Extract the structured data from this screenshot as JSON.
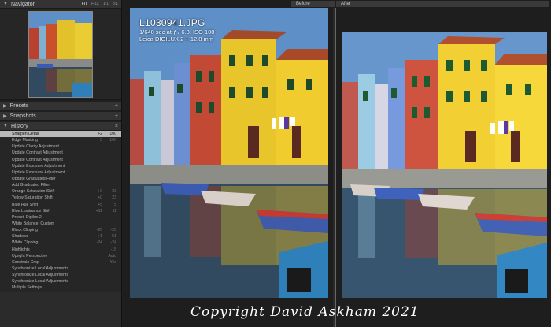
{
  "navigator": {
    "title": "Navigator",
    "zoom_options": [
      "FIT",
      "FILL",
      "1:1",
      "3:1"
    ]
  },
  "presets": {
    "title": "Presets",
    "action": "+"
  },
  "snapshots": {
    "title": "Snapshots",
    "action": "+"
  },
  "history": {
    "title": "History",
    "action": "×",
    "items": [
      {
        "label": "Sharpen Detail",
        "v1": "+2",
        "v2": "100",
        "selected": true
      },
      {
        "label": "Edge Masking",
        "v1": "3",
        "v2": "100"
      },
      {
        "label": "Update Clarity Adjustment",
        "v1": "",
        "v2": ""
      },
      {
        "label": "Update Contrast Adjustment",
        "v1": "",
        "v2": ""
      },
      {
        "label": "Update Contrast Adjustment",
        "v1": "",
        "v2": ""
      },
      {
        "label": "Update Exposure Adjustment",
        "v1": "",
        "v2": ""
      },
      {
        "label": "Update Exposure Adjustment",
        "v1": "",
        "v2": ""
      },
      {
        "label": "Update Graduated Filter",
        "v1": "",
        "v2": ""
      },
      {
        "label": "Add Graduated Filter",
        "v1": "",
        "v2": ""
      },
      {
        "label": "Orange Saturation Shift",
        "v1": "+0",
        "v2": "23"
      },
      {
        "label": "Yellow Saturation Shift",
        "v1": "+0",
        "v2": "23"
      },
      {
        "label": "Blue Hue Shift",
        "v1": "+5",
        "v2": "5"
      },
      {
        "label": "Blue Luminance Shift",
        "v1": "+11",
        "v2": "11"
      },
      {
        "label": "Preset: Digilux 2",
        "v1": "",
        "v2": ""
      },
      {
        "label": "White Balance: Custom",
        "v1": "",
        "v2": ""
      },
      {
        "label": "Black Clipping",
        "v1": "-20",
        "v2": "-20"
      },
      {
        "label": "Shadows",
        "v1": "+1",
        "v2": "51"
      },
      {
        "label": "White Clipping",
        "v1": "-24",
        "v2": "-24"
      },
      {
        "label": "Highlights",
        "v1": "",
        "v2": "-15"
      },
      {
        "label": "Upright Perspective",
        "v1": "",
        "v2": "Auto"
      },
      {
        "label": "Constrain Crop",
        "v1": "",
        "v2": "Yes"
      },
      {
        "label": "Synchronize Local Adjustments",
        "v1": "",
        "v2": ""
      },
      {
        "label": "Synchronize Local Adjustments",
        "v1": "",
        "v2": ""
      },
      {
        "label": "Synchronize Local Adjustments",
        "v1": "",
        "v2": ""
      },
      {
        "label": "Multiple Settings",
        "v1": "",
        "v2": ""
      }
    ]
  },
  "view": {
    "before_label": "Before",
    "after_label": "After"
  },
  "photo_info": {
    "filename": "L1030941.JPG",
    "exposure": "1/640 sec at ƒ / 6.3, ISO 100",
    "camera": "Leica DIGILUX 2 + 12.8 mm"
  },
  "copyright": "Copyright David Askham 2021",
  "colors": {
    "sky": "#5e8fc7",
    "yellow_house": "#e8c52a",
    "red_house": "#b8412f",
    "water": "#324a60"
  }
}
